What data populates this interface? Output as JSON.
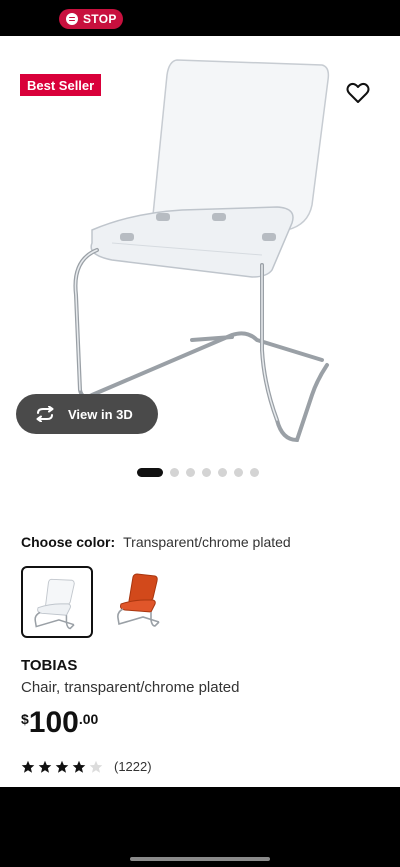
{
  "status_bar": {
    "stop_label": "STOP"
  },
  "gallery": {
    "badge": "Best Seller",
    "view_3d_label": "View in 3D",
    "slides": 7,
    "active_slide": 1
  },
  "color_chooser": {
    "label": "Choose color:",
    "selected_value": "Transparent/chrome plated",
    "swatches": [
      "transparent",
      "orange"
    ]
  },
  "product": {
    "name": "TOBIAS",
    "description": "Chair, transparent/chrome plated",
    "currency": "$",
    "price_whole": "100",
    "price_cents": ".00",
    "rating": 4,
    "rating_max": 5,
    "review_count": "(1222)"
  },
  "colors": {
    "badge": "#d9003a",
    "stop_pill": "#c8103e",
    "view3d_bg": "#4a4a4a"
  }
}
